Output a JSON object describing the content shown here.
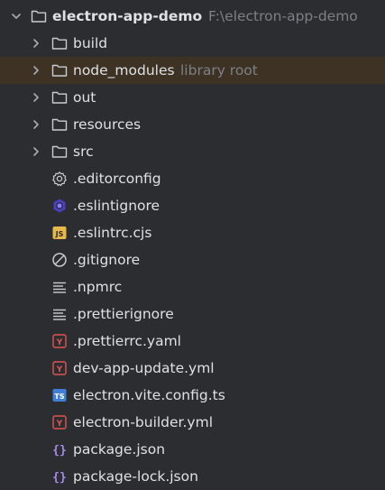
{
  "project": {
    "name": "electron-app-demo",
    "path": "F:\\electron-app-demo"
  },
  "folders": [
    {
      "name": "build",
      "hint": ""
    },
    {
      "name": "node_modules",
      "hint": "library root"
    },
    {
      "name": "out",
      "hint": ""
    },
    {
      "name": "resources",
      "hint": ""
    },
    {
      "name": "src",
      "hint": ""
    }
  ],
  "files": [
    {
      "name": ".editorconfig",
      "icon": "gear-icon"
    },
    {
      "name": ".eslintignore",
      "icon": "eslint-icon"
    },
    {
      "name": ".eslintrc.cjs",
      "icon": "js-file-icon"
    },
    {
      "name": ".gitignore",
      "icon": "ignore-file-icon"
    },
    {
      "name": ".npmrc",
      "icon": "text-file-icon"
    },
    {
      "name": ".prettierignore",
      "icon": "text-file-icon"
    },
    {
      "name": ".prettierrc.yaml",
      "icon": "yaml-file-icon"
    },
    {
      "name": "dev-app-update.yml",
      "icon": "yaml-file-icon"
    },
    {
      "name": "electron.vite.config.ts",
      "icon": "ts-file-icon"
    },
    {
      "name": "electron-builder.yml",
      "icon": "yaml-file-icon"
    },
    {
      "name": "package.json",
      "icon": "json-file-icon"
    },
    {
      "name": "package-lock.json",
      "icon": "json-file-icon"
    }
  ],
  "icon_glyphs": {
    "js": "JS",
    "ts": "TS",
    "yaml": "Y",
    "json": "{}"
  },
  "colors": {
    "background": "#2b2d30",
    "highlight_row": "#3d3223",
    "text": "#dfe1e5",
    "hint_text": "#7c8087",
    "folder_outline": "#c9ccd1",
    "js_badge": "#e8b84a",
    "ts_badge": "#3f7fd6",
    "yaml_outline": "#e05555",
    "json_braces": "#a98bef",
    "eslint_ring": "#6a5ef0"
  }
}
